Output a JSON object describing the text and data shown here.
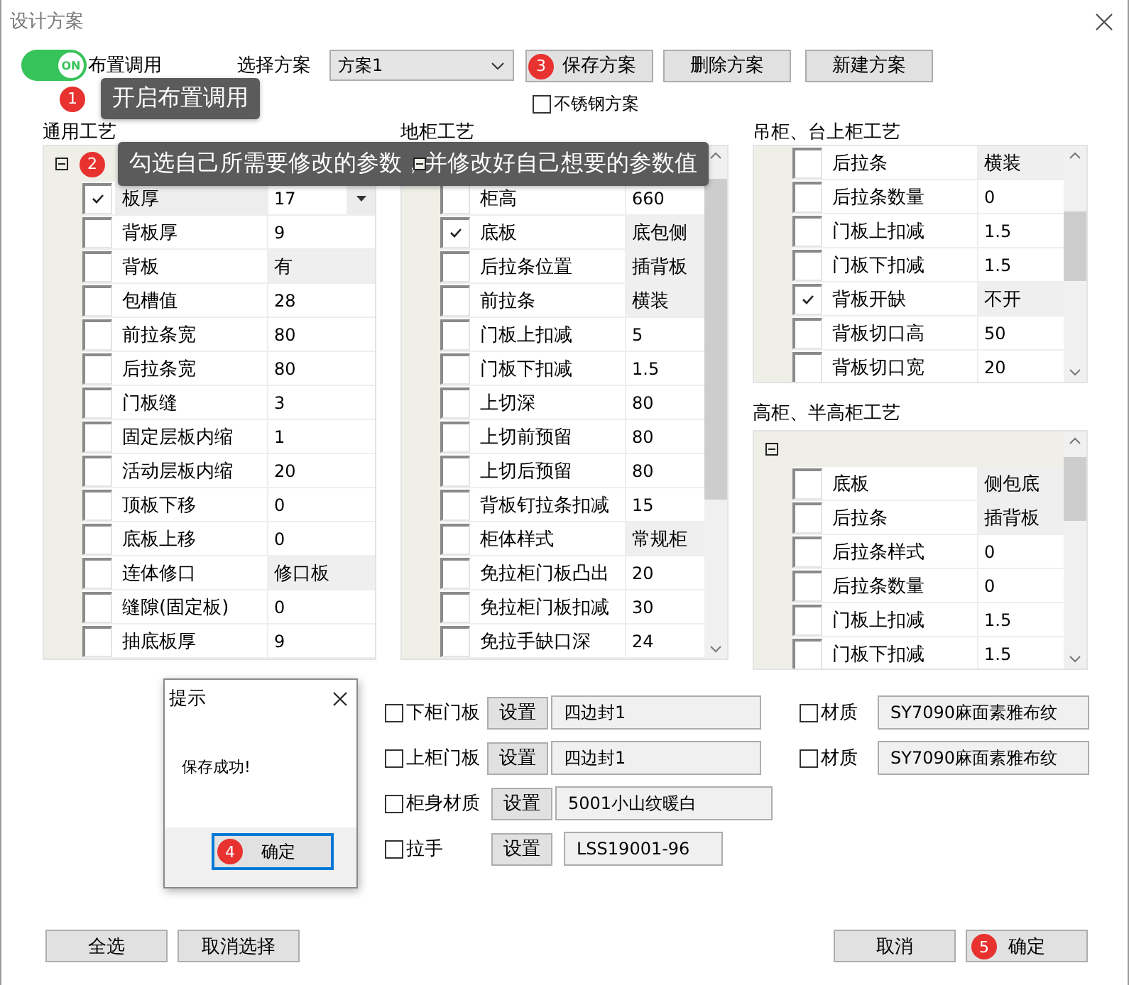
{
  "window": {
    "title": "设计方案"
  },
  "layout_toggle": {
    "on": true,
    "text": "ON",
    "label": "布置调用"
  },
  "scheme": {
    "label": "选择方案",
    "value": "方案1"
  },
  "scheme_buttons": [
    {
      "label": "保存方案",
      "badge": "3"
    },
    {
      "label": "删除方案"
    },
    {
      "label": "新建方案"
    }
  ],
  "stainless": {
    "label": "不锈钢方案",
    "checked": false
  },
  "panels": [
    {
      "title": "通用工艺",
      "expanded": true,
      "scrollable": false,
      "rows": [
        {
          "name": "板厚",
          "value": "17",
          "kind": "dropdown",
          "checked": true,
          "selected": true
        },
        {
          "name": "背板厚",
          "value": "9",
          "kind": "text",
          "checked": false,
          "selected": false
        },
        {
          "name": "背板",
          "value": "有",
          "kind": "choice",
          "checked": false,
          "selected": false
        },
        {
          "name": "包槽值",
          "value": "28",
          "kind": "text",
          "checked": false,
          "selected": false
        },
        {
          "name": "前拉条宽",
          "value": "80",
          "kind": "text",
          "checked": false,
          "selected": false
        },
        {
          "name": "后拉条宽",
          "value": "80",
          "kind": "text",
          "checked": false,
          "selected": false
        },
        {
          "name": "门板缝",
          "value": "3",
          "kind": "text",
          "checked": false,
          "selected": false
        },
        {
          "name": "固定层板内缩",
          "value": "1",
          "kind": "text",
          "checked": false,
          "selected": false
        },
        {
          "name": "活动层板内缩",
          "value": "20",
          "kind": "text",
          "checked": false,
          "selected": false
        },
        {
          "name": "顶板下移",
          "value": "0",
          "kind": "text",
          "checked": false,
          "selected": false
        },
        {
          "name": "底板上移",
          "value": "0",
          "kind": "text",
          "checked": false,
          "selected": false
        },
        {
          "name": "连体修口",
          "value": "修口板",
          "kind": "choice",
          "checked": false,
          "selected": false
        },
        {
          "name": "缝隙(固定板)",
          "value": "0",
          "kind": "text",
          "checked": false,
          "selected": false
        },
        {
          "name": "抽底板厚",
          "value": "9",
          "kind": "text",
          "checked": false,
          "selected": false
        }
      ]
    },
    {
      "title": "地柜工艺",
      "expanded": true,
      "scrollable": true,
      "rows": [
        {
          "name": "柜高",
          "value": "660",
          "kind": "text",
          "checked": false,
          "selected": false
        },
        {
          "name": "底板",
          "value": "底包侧",
          "kind": "choice",
          "checked": true,
          "selected": false
        },
        {
          "name": "后拉条位置",
          "value": "插背板",
          "kind": "choice",
          "checked": false,
          "selected": false
        },
        {
          "name": "前拉条",
          "value": "横装",
          "kind": "choice",
          "checked": false,
          "selected": false
        },
        {
          "name": "门板上扣减",
          "value": "5",
          "kind": "text",
          "checked": false,
          "selected": false
        },
        {
          "name": "门板下扣减",
          "value": "1.5",
          "kind": "text",
          "checked": false,
          "selected": false
        },
        {
          "name": "上切深",
          "value": "80",
          "kind": "text",
          "checked": false,
          "selected": false
        },
        {
          "name": "上切前预留",
          "value": "80",
          "kind": "text",
          "checked": false,
          "selected": false
        },
        {
          "name": "上切后预留",
          "value": "80",
          "kind": "text",
          "checked": false,
          "selected": false
        },
        {
          "name": "背板钉拉条扣减",
          "value": "15",
          "kind": "text",
          "checked": false,
          "selected": false
        },
        {
          "name": "柜体样式",
          "value": "常规柜",
          "kind": "choice",
          "checked": false,
          "selected": false
        },
        {
          "name": "免拉柜门板凸出",
          "value": "20",
          "kind": "text",
          "checked": false,
          "selected": false
        },
        {
          "name": "免拉柜门板扣减",
          "value": "30",
          "kind": "text",
          "checked": false,
          "selected": false
        },
        {
          "name": "免拉手缺口深",
          "value": "24",
          "kind": "text",
          "checked": false,
          "selected": false
        }
      ]
    },
    {
      "title": "吊柜、台上柜工艺",
      "scrollable": true,
      "rows": [
        {
          "name": "后拉条",
          "value": "横装",
          "kind": "choice",
          "checked": false,
          "selected": false
        },
        {
          "name": "后拉条数量",
          "value": "0",
          "kind": "text",
          "checked": false,
          "selected": false
        },
        {
          "name": "门板上扣减",
          "value": "1.5",
          "kind": "text",
          "checked": false,
          "selected": false
        },
        {
          "name": "门板下扣减",
          "value": "1.5",
          "kind": "text",
          "checked": false,
          "selected": false
        },
        {
          "name": "背板开缺",
          "value": "不开",
          "kind": "choice",
          "checked": true,
          "selected": false
        },
        {
          "name": "背板切口高",
          "value": "50",
          "kind": "text",
          "checked": false,
          "selected": false
        },
        {
          "name": "背板切口宽",
          "value": "20",
          "kind": "text",
          "checked": false,
          "selected": false
        }
      ]
    },
    {
      "title": "高柜、半高柜工艺",
      "expanded": true,
      "scrollable": true,
      "rows": [
        {
          "name": "底板",
          "value": "侧包底",
          "kind": "choice",
          "checked": false,
          "selected": false
        },
        {
          "name": "后拉条",
          "value": "插背板",
          "kind": "choice",
          "checked": false,
          "selected": false
        },
        {
          "name": "后拉条样式",
          "value": "0",
          "kind": "text",
          "checked": false,
          "selected": false
        },
        {
          "name": "后拉条数量",
          "value": "0",
          "kind": "text",
          "checked": false,
          "selected": false
        },
        {
          "name": "门板上扣减",
          "value": "1.5",
          "kind": "text",
          "checked": false,
          "selected": false
        },
        {
          "name": "门板下扣减",
          "value": "1.5",
          "kind": "text",
          "checked": false,
          "selected": false
        }
      ]
    }
  ],
  "materials": [
    {
      "label": "下柜门板",
      "checked": false,
      "button": "设置",
      "value": "四边封1",
      "extra": {
        "label": "材质",
        "checked": false,
        "value": "SY7090麻面素雅布纹"
      }
    },
    {
      "label": "上柜门板",
      "checked": false,
      "button": "设置",
      "value": "四边封1",
      "extra": {
        "label": "材质",
        "checked": false,
        "value": "SY7090麻面素雅布纹"
      }
    },
    {
      "label": "柜身材质",
      "checked": false,
      "button": "设置",
      "value": "5001小山纹暖白"
    },
    {
      "label": "拉手",
      "checked": false,
      "button": "设置",
      "value": "LSS19001-96"
    }
  ],
  "footer_left": [
    {
      "label": "全选"
    },
    {
      "label": "取消选择"
    }
  ],
  "footer_right": [
    {
      "label": "取消"
    },
    {
      "label": "确定",
      "badge": "5"
    }
  ],
  "dialog": {
    "title": "提示",
    "message": "保存成功!",
    "button": "确定",
    "badge": "4"
  },
  "tooltips": [
    {
      "badge": "1",
      "text": "开启布置调用"
    },
    {
      "badge": "2",
      "text": "勾选自己所需要修改的参数，并修改好自己想要的参数值"
    }
  ]
}
